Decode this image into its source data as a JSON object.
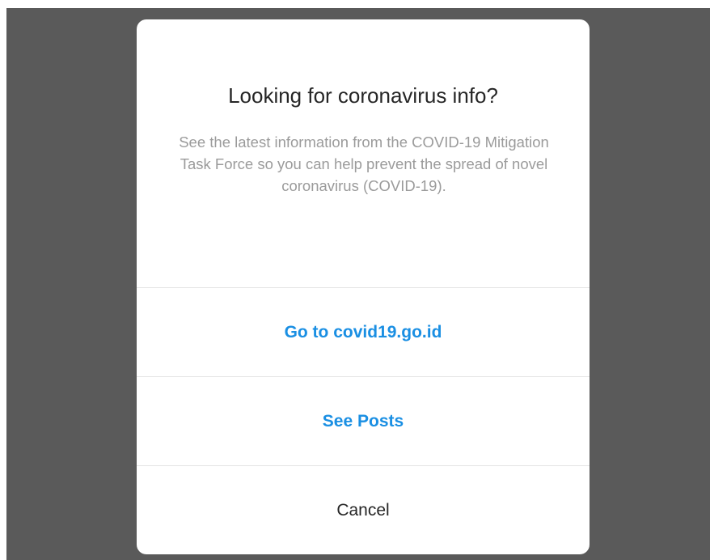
{
  "dialog": {
    "title": "Looking for coronavirus info?",
    "message": "See the latest information from the COVID-19 Mitigation Task Force so you can help prevent the spread of novel coronavirus (COVID-19).",
    "actions": {
      "visit_site_label": "Go to covid19.go.id",
      "see_posts_label": "See Posts",
      "cancel_label": "Cancel"
    }
  },
  "colors": {
    "overlay": "#5a5a5a",
    "link_blue": "#1a8fe3",
    "title_text": "#262626",
    "body_text": "#9b9b9b",
    "divider": "#e3e3e3"
  }
}
